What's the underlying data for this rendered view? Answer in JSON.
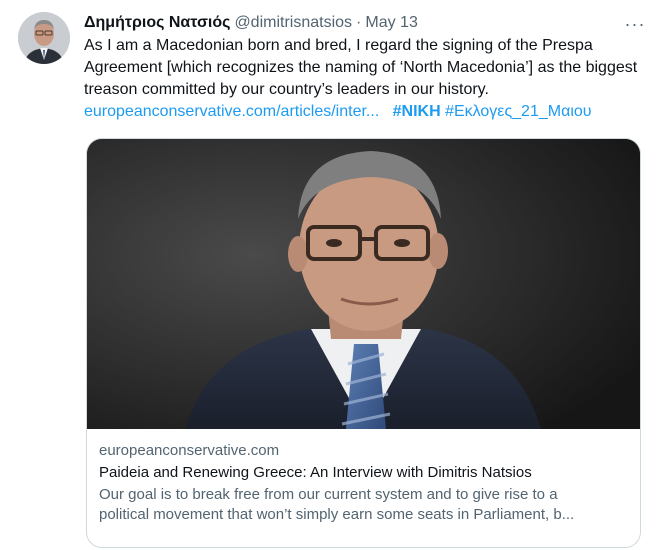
{
  "author": {
    "display_name": "Δημήτριος Νατσιός",
    "handle": "@dimitrisnatsios",
    "separator": "·",
    "date": "May 13"
  },
  "more_icon": "more-horizontal-icon",
  "more_label": "···",
  "tweet": {
    "text": "As I am a Macedonian born and bred, I regard the signing of the Prespa Agreement [which recognizes the naming of ‘North Macedonia’] as the biggest treason committed by our country’s leaders in our history.",
    "link": "europeanconservative.com/articles/inter...",
    "hashtag_1": "#ΝΙΚΗ",
    "hashtag_2": "#Εκλογες_21_Μαιου"
  },
  "card": {
    "domain": "europeanconservative.com",
    "title": "Paideia and Renewing Greece: An Interview with Dimitris Natsios",
    "description_line_1": "Our goal is to break free from our current system and to give rise to a",
    "description_line_2": "political movement that won’t simply earn some seats in Parliament, b..."
  },
  "colors": {
    "link": "#1d9bf0",
    "secondary_text": "#536471",
    "primary_text": "#0f1419",
    "border": "#cfd9de"
  }
}
